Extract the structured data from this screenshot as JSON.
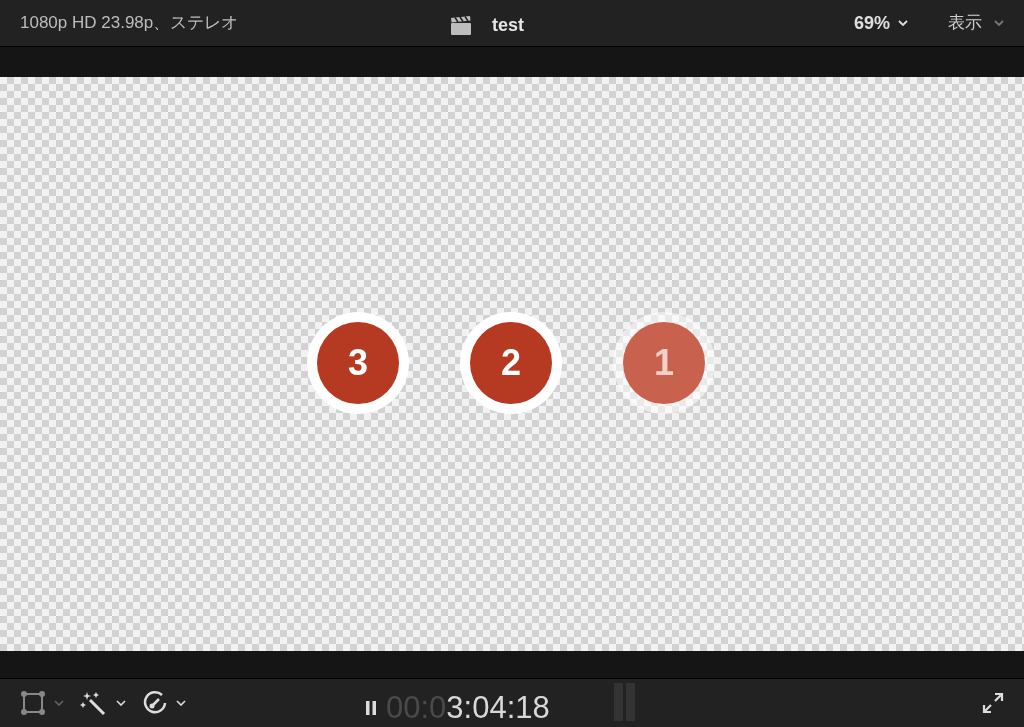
{
  "header": {
    "format": "1080p HD 23.98p、ステレオ",
    "title": "test",
    "zoom": "69%",
    "view_menu": "表示"
  },
  "badges": [
    {
      "label": "3",
      "faded": false
    },
    {
      "label": "2",
      "faded": false
    },
    {
      "label": "1",
      "faded": true
    }
  ],
  "timecode": {
    "dim_part": "00:0",
    "lit_part": "3:04:18"
  },
  "playing": true
}
